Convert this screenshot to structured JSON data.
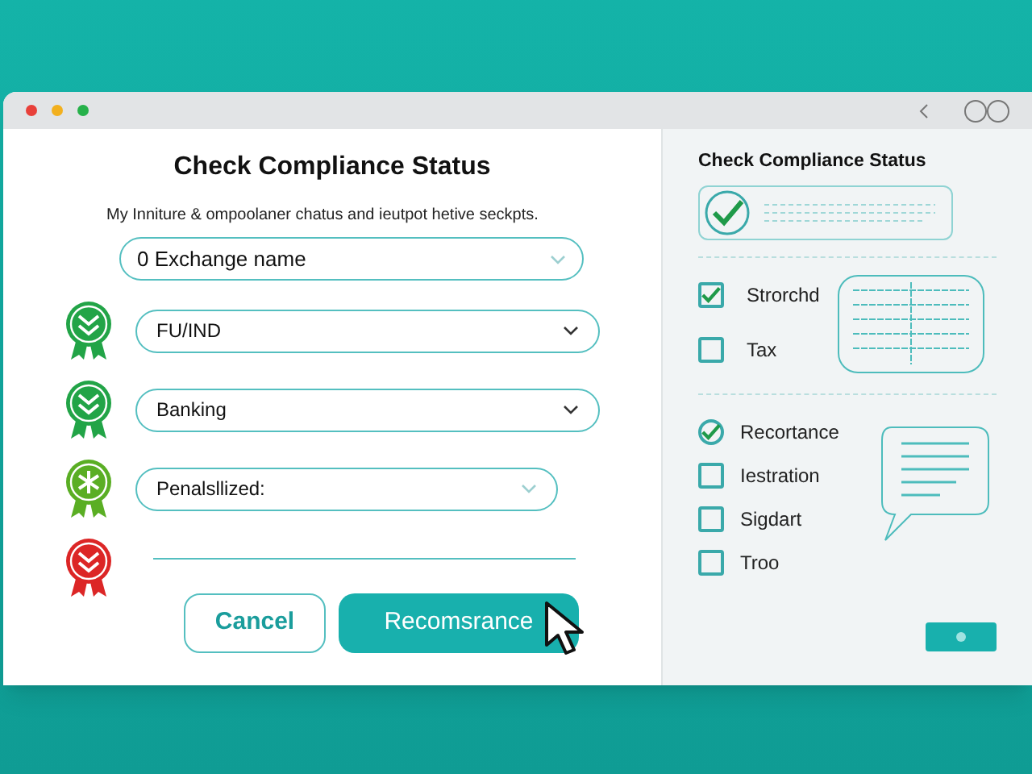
{
  "main": {
    "title": "Check Compliance Status",
    "subtitle": "My Inniture & ompoolaner chatus and ieutpot hetive seckpts.",
    "exchange_field": {
      "value": "0 Exchange name"
    },
    "rows": [
      {
        "kind": "select",
        "color": "#22a447",
        "value": "FU/IND"
      },
      {
        "kind": "select",
        "color": "#22a447",
        "value": "Banking"
      },
      {
        "kind": "select",
        "color": "#5aae24",
        "value": "Penalsllized:"
      },
      {
        "kind": "line",
        "color": "#dc2626"
      }
    ],
    "buttons": [
      {
        "kind": "outline",
        "label": "Cancel"
      },
      {
        "kind": "primary",
        "label": "Recomsrance"
      }
    ]
  },
  "side": {
    "title": "Check Compliance Status",
    "group_1": [
      {
        "label": "Strorchd",
        "checked": true
      },
      {
        "label": "Tax",
        "checked": false
      }
    ],
    "group_2": [
      {
        "label": "Recortance",
        "checked": true
      },
      {
        "label": "Iestration",
        "checked": false
      },
      {
        "label": "Sigdart",
        "checked": false
      },
      {
        "label": "Troo",
        "checked": false
      }
    ]
  }
}
